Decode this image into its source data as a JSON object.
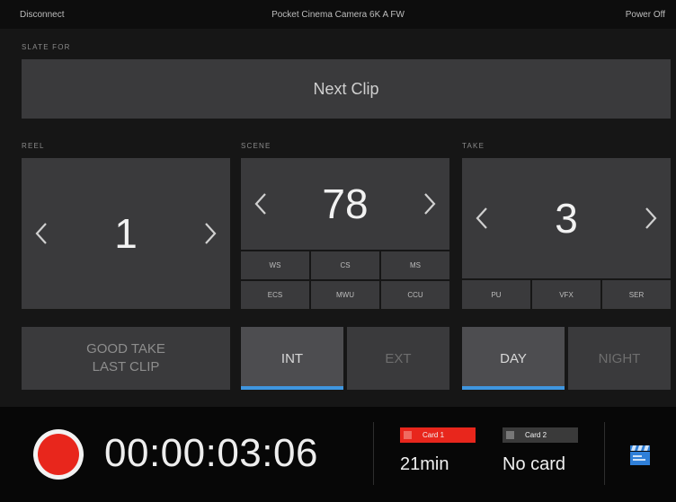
{
  "topbar": {
    "left": "Disconnect",
    "center": "Pocket Cinema Camera 6K A FW",
    "right": "Power Off"
  },
  "slate": {
    "label": "SLATE FOR",
    "value": "Next Clip"
  },
  "reel": {
    "label": "REEL",
    "value": "1"
  },
  "scene": {
    "label": "SCENE",
    "value": "78",
    "chips_row1": [
      "WS",
      "CS",
      "MS"
    ],
    "chips_row2": [
      "ECS",
      "MWU",
      "CCU"
    ]
  },
  "take": {
    "label": "TAKE",
    "value": "3",
    "chips": [
      "PU",
      "VFX",
      "SER"
    ]
  },
  "good_take": {
    "line1": "GOOD TAKE",
    "line2": "LAST CLIP"
  },
  "int_ext": {
    "int": "INT",
    "ext": "EXT",
    "selected": "INT"
  },
  "day_night": {
    "day": "DAY",
    "night": "NIGHT",
    "selected": "DAY"
  },
  "recording": {
    "timecode": "00:00:03:06",
    "card1": {
      "label": "Card 1",
      "value": "21min",
      "color": "#e8261c"
    },
    "card2": {
      "label": "Card 2",
      "value": "No card",
      "color": "#4a4a4a"
    }
  },
  "colors": {
    "accent": "#3f96e0",
    "record": "#e8261c"
  },
  "icons": [
    "chevron-left-icon",
    "chevron-right-icon",
    "record-icon",
    "clapperboard-icon"
  ]
}
